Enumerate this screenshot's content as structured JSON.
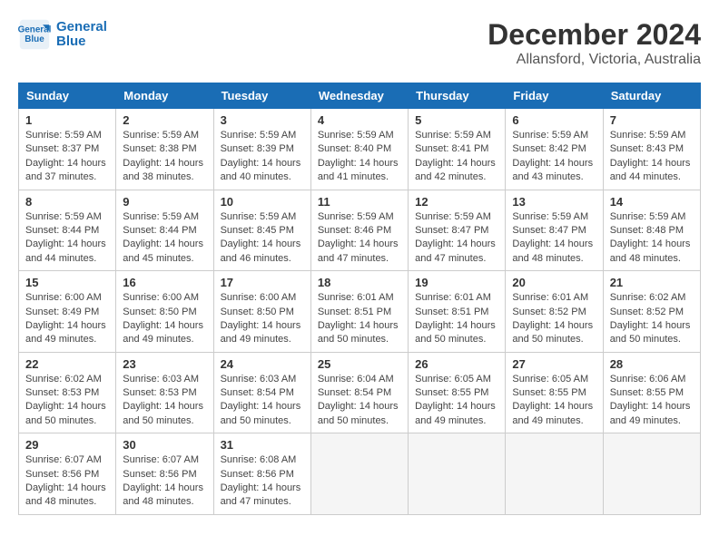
{
  "logo": {
    "line1": "General",
    "line2": "Blue"
  },
  "title": "December 2024",
  "subtitle": "Allansford, Victoria, Australia",
  "headers": [
    "Sunday",
    "Monday",
    "Tuesday",
    "Wednesday",
    "Thursday",
    "Friday",
    "Saturday"
  ],
  "weeks": [
    [
      {
        "day": "1",
        "sunrise": "5:59 AM",
        "sunset": "8:37 PM",
        "daylight": "14 hours and 37 minutes."
      },
      {
        "day": "2",
        "sunrise": "5:59 AM",
        "sunset": "8:38 PM",
        "daylight": "14 hours and 38 minutes."
      },
      {
        "day": "3",
        "sunrise": "5:59 AM",
        "sunset": "8:39 PM",
        "daylight": "14 hours and 40 minutes."
      },
      {
        "day": "4",
        "sunrise": "5:59 AM",
        "sunset": "8:40 PM",
        "daylight": "14 hours and 41 minutes."
      },
      {
        "day": "5",
        "sunrise": "5:59 AM",
        "sunset": "8:41 PM",
        "daylight": "14 hours and 42 minutes."
      },
      {
        "day": "6",
        "sunrise": "5:59 AM",
        "sunset": "8:42 PM",
        "daylight": "14 hours and 43 minutes."
      },
      {
        "day": "7",
        "sunrise": "5:59 AM",
        "sunset": "8:43 PM",
        "daylight": "14 hours and 44 minutes."
      }
    ],
    [
      {
        "day": "8",
        "sunrise": "5:59 AM",
        "sunset": "8:44 PM",
        "daylight": "14 hours and 44 minutes."
      },
      {
        "day": "9",
        "sunrise": "5:59 AM",
        "sunset": "8:44 PM",
        "daylight": "14 hours and 45 minutes."
      },
      {
        "day": "10",
        "sunrise": "5:59 AM",
        "sunset": "8:45 PM",
        "daylight": "14 hours and 46 minutes."
      },
      {
        "day": "11",
        "sunrise": "5:59 AM",
        "sunset": "8:46 PM",
        "daylight": "14 hours and 47 minutes."
      },
      {
        "day": "12",
        "sunrise": "5:59 AM",
        "sunset": "8:47 PM",
        "daylight": "14 hours and 47 minutes."
      },
      {
        "day": "13",
        "sunrise": "5:59 AM",
        "sunset": "8:47 PM",
        "daylight": "14 hours and 48 minutes."
      },
      {
        "day": "14",
        "sunrise": "5:59 AM",
        "sunset": "8:48 PM",
        "daylight": "14 hours and 48 minutes."
      }
    ],
    [
      {
        "day": "15",
        "sunrise": "6:00 AM",
        "sunset": "8:49 PM",
        "daylight": "14 hours and 49 minutes."
      },
      {
        "day": "16",
        "sunrise": "6:00 AM",
        "sunset": "8:50 PM",
        "daylight": "14 hours and 49 minutes."
      },
      {
        "day": "17",
        "sunrise": "6:00 AM",
        "sunset": "8:50 PM",
        "daylight": "14 hours and 49 minutes."
      },
      {
        "day": "18",
        "sunrise": "6:01 AM",
        "sunset": "8:51 PM",
        "daylight": "14 hours and 50 minutes."
      },
      {
        "day": "19",
        "sunrise": "6:01 AM",
        "sunset": "8:51 PM",
        "daylight": "14 hours and 50 minutes."
      },
      {
        "day": "20",
        "sunrise": "6:01 AM",
        "sunset": "8:52 PM",
        "daylight": "14 hours and 50 minutes."
      },
      {
        "day": "21",
        "sunrise": "6:02 AM",
        "sunset": "8:52 PM",
        "daylight": "14 hours and 50 minutes."
      }
    ],
    [
      {
        "day": "22",
        "sunrise": "6:02 AM",
        "sunset": "8:53 PM",
        "daylight": "14 hours and 50 minutes."
      },
      {
        "day": "23",
        "sunrise": "6:03 AM",
        "sunset": "8:53 PM",
        "daylight": "14 hours and 50 minutes."
      },
      {
        "day": "24",
        "sunrise": "6:03 AM",
        "sunset": "8:54 PM",
        "daylight": "14 hours and 50 minutes."
      },
      {
        "day": "25",
        "sunrise": "6:04 AM",
        "sunset": "8:54 PM",
        "daylight": "14 hours and 50 minutes."
      },
      {
        "day": "26",
        "sunrise": "6:05 AM",
        "sunset": "8:55 PM",
        "daylight": "14 hours and 49 minutes."
      },
      {
        "day": "27",
        "sunrise": "6:05 AM",
        "sunset": "8:55 PM",
        "daylight": "14 hours and 49 minutes."
      },
      {
        "day": "28",
        "sunrise": "6:06 AM",
        "sunset": "8:55 PM",
        "daylight": "14 hours and 49 minutes."
      }
    ],
    [
      {
        "day": "29",
        "sunrise": "6:07 AM",
        "sunset": "8:56 PM",
        "daylight": "14 hours and 48 minutes."
      },
      {
        "day": "30",
        "sunrise": "6:07 AM",
        "sunset": "8:56 PM",
        "daylight": "14 hours and 48 minutes."
      },
      {
        "day": "31",
        "sunrise": "6:08 AM",
        "sunset": "8:56 PM",
        "daylight": "14 hours and 47 minutes."
      },
      null,
      null,
      null,
      null
    ]
  ],
  "labels": {
    "sunrise": "Sunrise:",
    "sunset": "Sunset:",
    "daylight": "Daylight:"
  }
}
